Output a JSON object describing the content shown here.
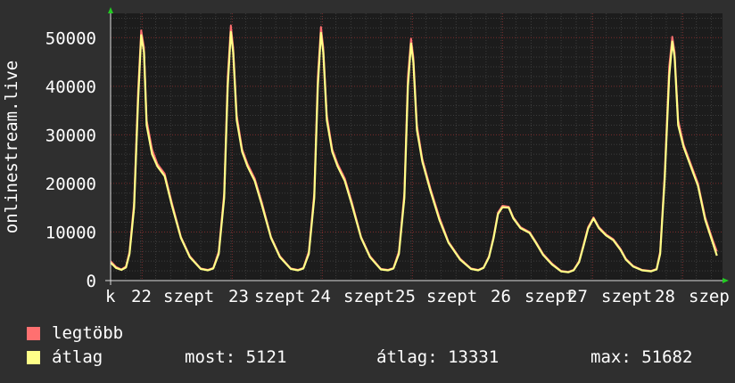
{
  "chart_data": {
    "type": "line",
    "ylabel": "onlinestream.live",
    "ylim": [
      0,
      55000
    ],
    "y_ticks": [
      0,
      10000,
      20000,
      30000,
      40000,
      50000
    ],
    "y_tick_labels": [
      "0",
      "10000",
      "20000",
      "30000",
      "40000",
      "50000"
    ],
    "x_tick_labels": [
      "k",
      "22",
      "szept",
      "23",
      "szept",
      "24",
      "szept",
      "25",
      "szept",
      "26",
      "szept",
      "27",
      "szept",
      "28",
      "szep"
    ],
    "grid": true,
    "colors": {
      "background": "#2f2f2f",
      "plot": "#1c1c1c",
      "grid_minor": "#3c3c3c",
      "grid_major": "#7a2b2b",
      "max_series": "#ff6f6f",
      "avg_series": "#ffff88",
      "axis_arrow": "#22cc22"
    },
    "series": [
      {
        "name": "legtöbb",
        "color": "#ff7070",
        "points": [
          [
            0,
            4000
          ],
          [
            0.06,
            2800
          ],
          [
            0.12,
            2300
          ],
          [
            0.17,
            2900
          ],
          [
            0.21,
            6000
          ],
          [
            0.26,
            16000
          ],
          [
            0.305,
            39000
          ],
          [
            0.34,
            51500
          ],
          [
            0.37,
            48000
          ],
          [
            0.4,
            33000
          ],
          [
            0.46,
            27000
          ],
          [
            0.52,
            24000
          ],
          [
            0.6,
            22000
          ],
          [
            0.68,
            16000
          ],
          [
            0.78,
            9000
          ],
          [
            0.88,
            5000
          ],
          [
            1,
            2500
          ],
          [
            1.08,
            2200
          ],
          [
            1.14,
            2600
          ],
          [
            1.2,
            6000
          ],
          [
            1.26,
            18000
          ],
          [
            1.3,
            42000
          ],
          [
            1.335,
            52500
          ],
          [
            1.36,
            48000
          ],
          [
            1.4,
            34000
          ],
          [
            1.46,
            27000
          ],
          [
            1.52,
            24000
          ],
          [
            1.6,
            21000
          ],
          [
            1.68,
            16000
          ],
          [
            1.78,
            9000
          ],
          [
            1.88,
            5000
          ],
          [
            2,
            2500
          ],
          [
            2.08,
            2200
          ],
          [
            2.14,
            2600
          ],
          [
            2.2,
            6000
          ],
          [
            2.26,
            18000
          ],
          [
            2.3,
            42000
          ],
          [
            2.335,
            52200
          ],
          [
            2.36,
            48000
          ],
          [
            2.4,
            34000
          ],
          [
            2.46,
            27000
          ],
          [
            2.52,
            24000
          ],
          [
            2.6,
            21000
          ],
          [
            2.68,
            16000
          ],
          [
            2.78,
            9000
          ],
          [
            2.88,
            5000
          ],
          [
            3,
            2400
          ],
          [
            3.08,
            2200
          ],
          [
            3.14,
            2600
          ],
          [
            3.2,
            6000
          ],
          [
            3.26,
            18000
          ],
          [
            3.3,
            42000
          ],
          [
            3.335,
            49800
          ],
          [
            3.36,
            46000
          ],
          [
            3.4,
            32000
          ],
          [
            3.46,
            25000
          ],
          [
            3.55,
            19000
          ],
          [
            3.65,
            13000
          ],
          [
            3.75,
            8000
          ],
          [
            3.88,
            4500
          ],
          [
            4,
            2500
          ],
          [
            4.08,
            2200
          ],
          [
            4.14,
            2700
          ],
          [
            4.2,
            5000
          ],
          [
            4.25,
            9000
          ],
          [
            4.3,
            14000
          ],
          [
            4.35,
            15400
          ],
          [
            4.42,
            15200
          ],
          [
            4.47,
            13000
          ],
          [
            4.55,
            11000
          ],
          [
            4.65,
            10000
          ],
          [
            4.72,
            8000
          ],
          [
            4.8,
            5500
          ],
          [
            4.9,
            3500
          ],
          [
            5,
            2000
          ],
          [
            5.08,
            1800
          ],
          [
            5.14,
            2200
          ],
          [
            5.2,
            4000
          ],
          [
            5.25,
            7500
          ],
          [
            5.3,
            11000
          ],
          [
            5.36,
            13000
          ],
          [
            5.42,
            11000
          ],
          [
            5.5,
            9500
          ],
          [
            5.58,
            8500
          ],
          [
            5.66,
            6500
          ],
          [
            5.72,
            4500
          ],
          [
            5.8,
            3000
          ],
          [
            5.9,
            2200
          ],
          [
            6,
            2000
          ],
          [
            6.06,
            2400
          ],
          [
            6.1,
            6000
          ],
          [
            6.15,
            22000
          ],
          [
            6.2,
            44000
          ],
          [
            6.235,
            50200
          ],
          [
            6.26,
            47000
          ],
          [
            6.3,
            33000
          ],
          [
            6.36,
            28000
          ],
          [
            6.44,
            24000
          ],
          [
            6.52,
            20000
          ],
          [
            6.6,
            13000
          ],
          [
            6.68,
            8500
          ],
          [
            6.73,
            6000
          ]
        ]
      },
      {
        "name": "átlag",
        "color": "#ffff88",
        "points": [
          [
            0,
            3700
          ],
          [
            0.06,
            2600
          ],
          [
            0.12,
            2200
          ],
          [
            0.17,
            2700
          ],
          [
            0.21,
            5500
          ],
          [
            0.26,
            15000
          ],
          [
            0.305,
            37000
          ],
          [
            0.34,
            50500
          ],
          [
            0.37,
            47000
          ],
          [
            0.4,
            32000
          ],
          [
            0.46,
            26000
          ],
          [
            0.52,
            23500
          ],
          [
            0.6,
            21500
          ],
          [
            0.68,
            15500
          ],
          [
            0.78,
            8800
          ],
          [
            0.88,
            4800
          ],
          [
            1,
            2400
          ],
          [
            1.08,
            2100
          ],
          [
            1.14,
            2500
          ],
          [
            1.2,
            5500
          ],
          [
            1.26,
            17000
          ],
          [
            1.3,
            40000
          ],
          [
            1.335,
            51200
          ],
          [
            1.36,
            47000
          ],
          [
            1.4,
            33000
          ],
          [
            1.46,
            26500
          ],
          [
            1.52,
            23500
          ],
          [
            1.6,
            20500
          ],
          [
            1.68,
            15500
          ],
          [
            1.78,
            8800
          ],
          [
            1.88,
            4800
          ],
          [
            2,
            2400
          ],
          [
            2.08,
            2100
          ],
          [
            2.14,
            2500
          ],
          [
            2.2,
            5500
          ],
          [
            2.26,
            17000
          ],
          [
            2.3,
            40000
          ],
          [
            2.335,
            51000
          ],
          [
            2.36,
            47000
          ],
          [
            2.4,
            33000
          ],
          [
            2.46,
            26500
          ],
          [
            2.52,
            23500
          ],
          [
            2.6,
            20500
          ],
          [
            2.68,
            15500
          ],
          [
            2.78,
            8800
          ],
          [
            2.88,
            4800
          ],
          [
            3,
            2300
          ],
          [
            3.08,
            2100
          ],
          [
            3.14,
            2500
          ],
          [
            3.2,
            5500
          ],
          [
            3.26,
            17000
          ],
          [
            3.3,
            40000
          ],
          [
            3.335,
            48800
          ],
          [
            3.36,
            45000
          ],
          [
            3.4,
            31000
          ],
          [
            3.46,
            24500
          ],
          [
            3.55,
            18500
          ],
          [
            3.65,
            12500
          ],
          [
            3.75,
            7800
          ],
          [
            3.88,
            4300
          ],
          [
            4,
            2400
          ],
          [
            4.08,
            2100
          ],
          [
            4.14,
            2600
          ],
          [
            4.2,
            4800
          ],
          [
            4.25,
            8700
          ],
          [
            4.3,
            13700
          ],
          [
            4.35,
            15100
          ],
          [
            4.42,
            15000
          ],
          [
            4.47,
            12800
          ],
          [
            4.55,
            10800
          ],
          [
            4.65,
            9800
          ],
          [
            4.72,
            7800
          ],
          [
            4.8,
            5300
          ],
          [
            4.9,
            3300
          ],
          [
            5,
            1900
          ],
          [
            5.08,
            1700
          ],
          [
            5.14,
            2100
          ],
          [
            5.2,
            3800
          ],
          [
            5.25,
            7200
          ],
          [
            5.3,
            10700
          ],
          [
            5.36,
            12800
          ],
          [
            5.42,
            10800
          ],
          [
            5.5,
            9300
          ],
          [
            5.58,
            8300
          ],
          [
            5.66,
            6300
          ],
          [
            5.72,
            4300
          ],
          [
            5.8,
            2900
          ],
          [
            5.9,
            2100
          ],
          [
            6,
            1900
          ],
          [
            6.06,
            2300
          ],
          [
            6.1,
            5500
          ],
          [
            6.15,
            21000
          ],
          [
            6.2,
            42000
          ],
          [
            6.235,
            49200
          ],
          [
            6.26,
            46000
          ],
          [
            6.3,
            32000
          ],
          [
            6.36,
            27500
          ],
          [
            6.44,
            23500
          ],
          [
            6.52,
            19500
          ],
          [
            6.6,
            12500
          ],
          [
            6.68,
            8000
          ],
          [
            6.73,
            5121
          ]
        ]
      }
    ]
  },
  "legend": {
    "max_label": "legtöbb",
    "avg_label": "átlag",
    "now_text": "most: 5121",
    "avg_text": "átlag: 13331",
    "max_text": "max: 51682"
  }
}
